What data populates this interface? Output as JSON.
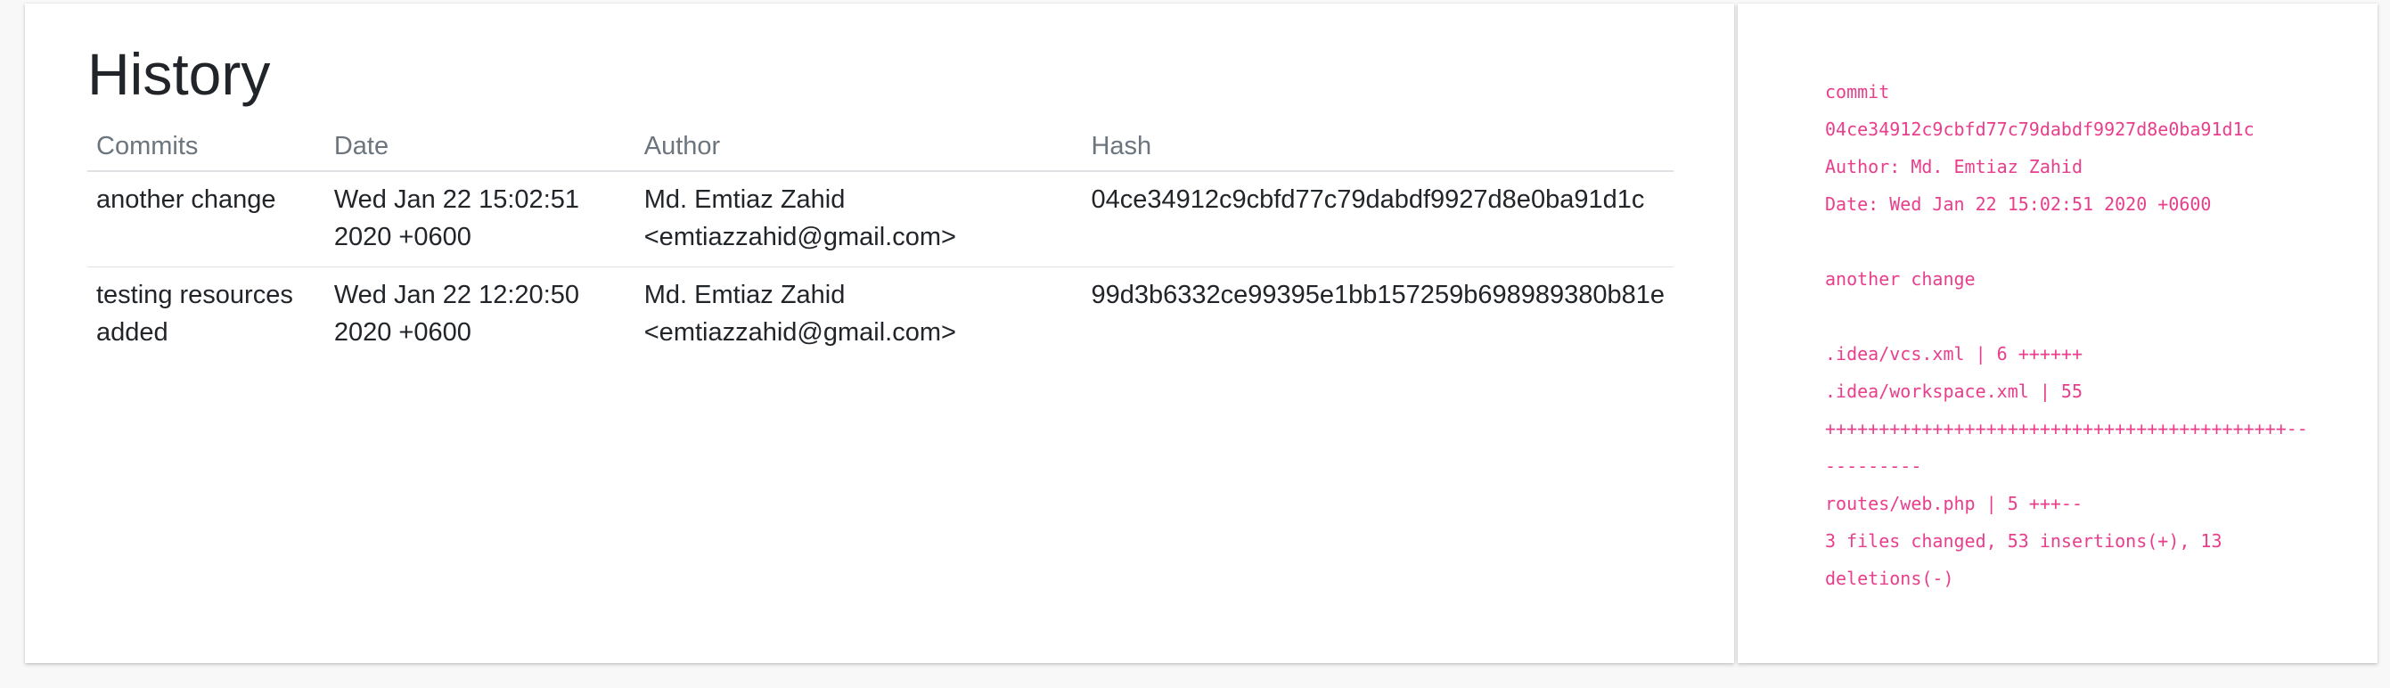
{
  "main": {
    "title": "History",
    "columns": {
      "commits": "Commits",
      "date": "Date",
      "author": "Author",
      "hash": "Hash"
    },
    "rows": [
      {
        "commit": "another change",
        "date": "Wed Jan 22 15:02:51 2020 +0600",
        "author": "Md. Emtiaz Zahid <emtiazzahid@gmail.com>",
        "hash": "04ce34912c9cbfd77c79dabdf9927d8e0ba91d1c"
      },
      {
        "commit": "testing resources added",
        "date": "Wed Jan 22 12:20:50 2020 +0600",
        "author": "Md. Emtiaz Zahid <emtiazzahid@gmail.com>",
        "hash": "99d3b6332ce99395e1bb157259b698989380b81e"
      }
    ]
  },
  "details": {
    "text": "commit\n04ce34912c9cbfd77c79dabdf9927d8e0ba91d1c\nAuthor: Md. Emtiaz Zahid\nDate: Wed Jan 22 15:02:51 2020 +0600\n\nanother change\n\n.idea/vcs.xml | 6 ++++++\n.idea/workspace.xml | 55\n+++++++++++++++++++++++++++++++++++++++++++--\n---------\nroutes/web.php | 5 +++--\n3 files changed, 53 insertions(+), 13\ndeletions(-)",
    "accent_color": "#e83e8c"
  }
}
